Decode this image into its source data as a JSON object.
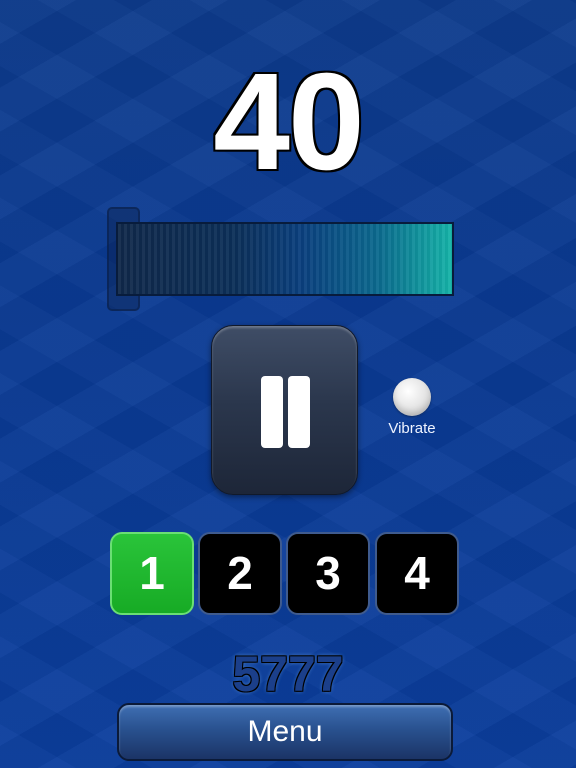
{
  "counter": {
    "value": "40"
  },
  "meter": {
    "level": 1.0
  },
  "controls": {
    "pause_icon": "pause-icon"
  },
  "vibrate": {
    "label": "Vibrate",
    "state": "off"
  },
  "selector": {
    "options": [
      "1",
      "2",
      "3",
      "4"
    ],
    "selected": "1",
    "colors": {
      "active": "#1bb22a",
      "inactive": "#000000"
    }
  },
  "score": {
    "value": "5777"
  },
  "menu": {
    "label": "Menu"
  },
  "colors": {
    "background": "#0b3a93",
    "accent": "#15b4a8"
  }
}
